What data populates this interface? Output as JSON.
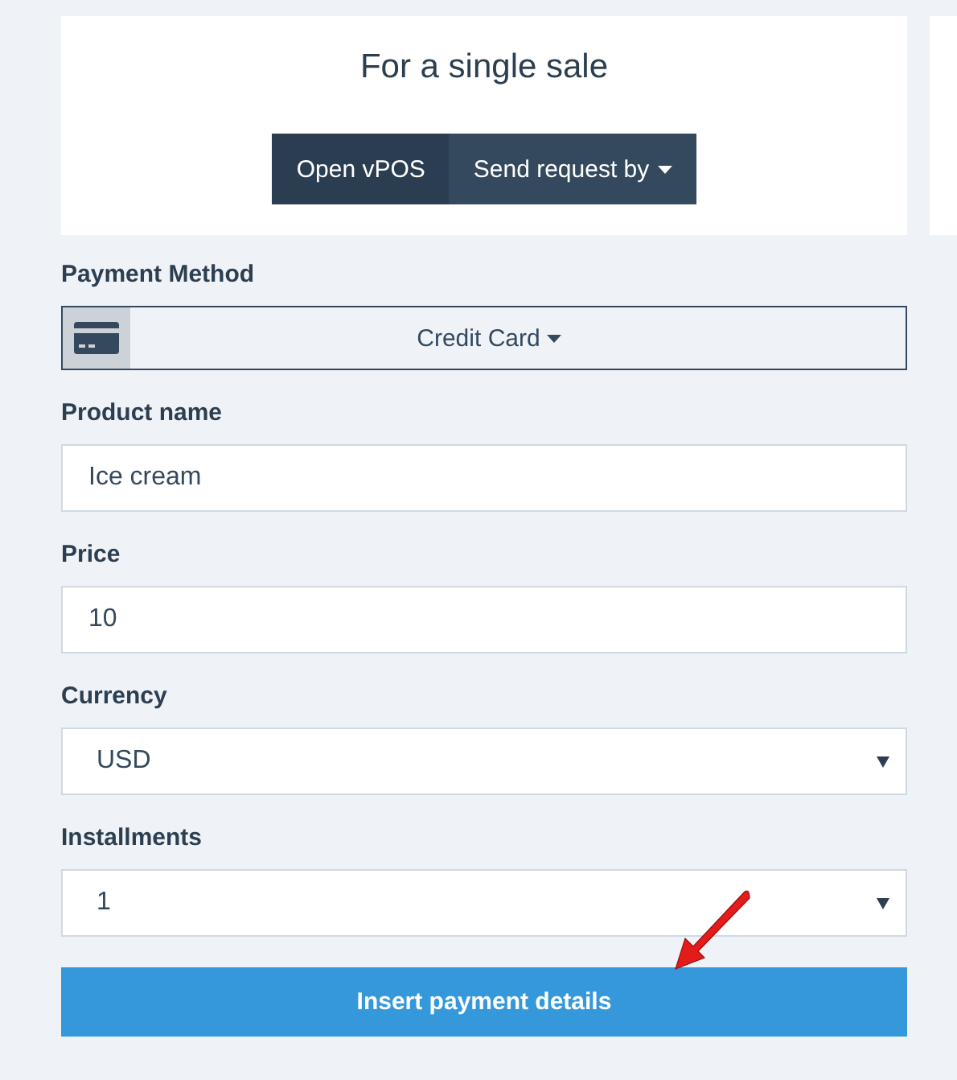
{
  "card": {
    "title": "For a single sale",
    "actions": [
      {
        "label": "Open vPOS",
        "selected": true,
        "kind": "plain"
      },
      {
        "label": "Send request by",
        "selected": false,
        "kind": "dropdown"
      }
    ]
  },
  "payment_method": {
    "label": "Payment Method",
    "value": "Credit Card"
  },
  "fields": [
    {
      "label": "Product name",
      "kind": "input",
      "value": "Ice cream"
    },
    {
      "label": "Price",
      "kind": "input",
      "value": "10"
    },
    {
      "label": "Currency",
      "kind": "select",
      "value": "USD"
    },
    {
      "label": "Installments",
      "kind": "select",
      "value": "1"
    }
  ],
  "submit": {
    "label": "Insert payment details"
  }
}
